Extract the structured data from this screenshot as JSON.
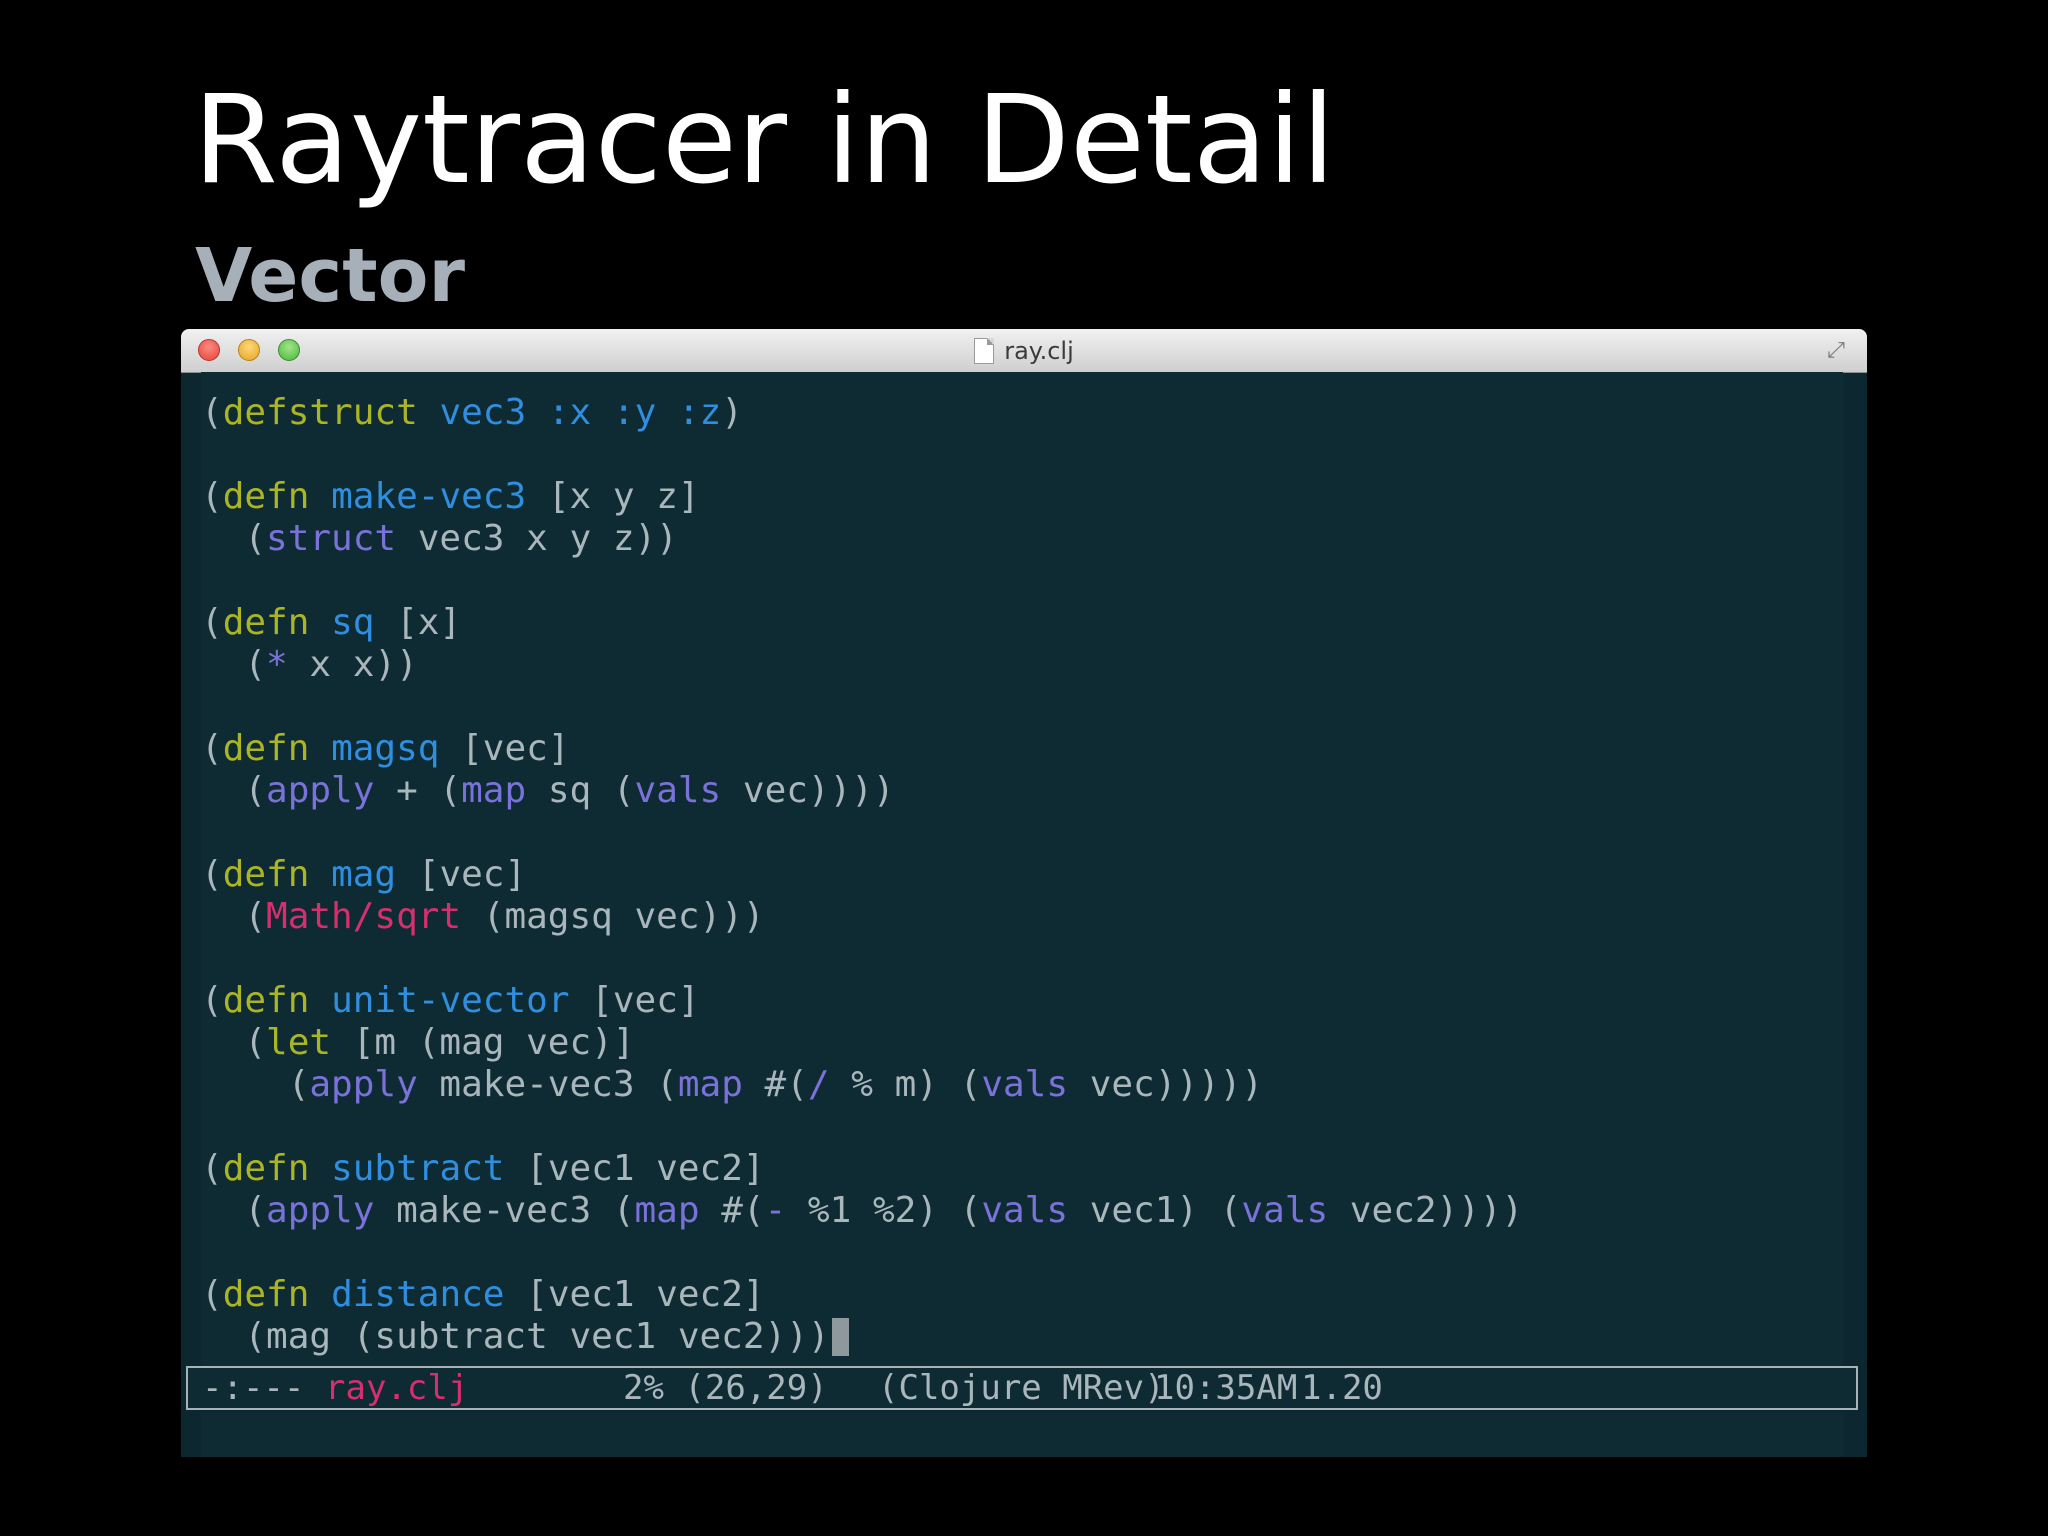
{
  "slide": {
    "title": "Raytracer in Detail",
    "subtitle": "Vector"
  },
  "window": {
    "title": "ray.clj"
  },
  "code_lines": [
    [
      {
        "t": "(",
        "c": ""
      },
      {
        "t": "defstruct",
        "c": "kw"
      },
      {
        "t": " ",
        "c": ""
      },
      {
        "t": "vec3",
        "c": "fn"
      },
      {
        "t": " ",
        "c": ""
      },
      {
        "t": ":x",
        "c": "fn"
      },
      {
        "t": " ",
        "c": ""
      },
      {
        "t": ":y",
        "c": "fn"
      },
      {
        "t": " ",
        "c": ""
      },
      {
        "t": ":z",
        "c": "fn"
      },
      {
        "t": ")",
        "c": ""
      }
    ],
    [],
    [
      {
        "t": "(",
        "c": ""
      },
      {
        "t": "defn",
        "c": "kw"
      },
      {
        "t": " ",
        "c": ""
      },
      {
        "t": "make-vec3",
        "c": "fn"
      },
      {
        "t": " [x y z]",
        "c": ""
      }
    ],
    [
      {
        "t": "  (",
        "c": ""
      },
      {
        "t": "struct",
        "c": "bi"
      },
      {
        "t": " vec3 x y z))",
        "c": ""
      }
    ],
    [],
    [
      {
        "t": "(",
        "c": ""
      },
      {
        "t": "defn",
        "c": "kw"
      },
      {
        "t": " ",
        "c": ""
      },
      {
        "t": "sq",
        "c": "fn"
      },
      {
        "t": " [x]",
        "c": ""
      }
    ],
    [
      {
        "t": "  (",
        "c": ""
      },
      {
        "t": "*",
        "c": "bi"
      },
      {
        "t": " x x))",
        "c": ""
      }
    ],
    [],
    [
      {
        "t": "(",
        "c": ""
      },
      {
        "t": "defn",
        "c": "kw"
      },
      {
        "t": " ",
        "c": ""
      },
      {
        "t": "magsq",
        "c": "fn"
      },
      {
        "t": " [vec]",
        "c": ""
      }
    ],
    [
      {
        "t": "  (",
        "c": ""
      },
      {
        "t": "apply",
        "c": "bi"
      },
      {
        "t": " + (",
        "c": ""
      },
      {
        "t": "map",
        "c": "bi"
      },
      {
        "t": " sq (",
        "c": ""
      },
      {
        "t": "vals",
        "c": "bi"
      },
      {
        "t": " vec))))",
        "c": ""
      }
    ],
    [],
    [
      {
        "t": "(",
        "c": ""
      },
      {
        "t": "defn",
        "c": "kw"
      },
      {
        "t": " ",
        "c": ""
      },
      {
        "t": "mag",
        "c": "fn"
      },
      {
        "t": " [vec]",
        "c": ""
      }
    ],
    [
      {
        "t": "  (",
        "c": ""
      },
      {
        "t": "Math/sqrt",
        "c": "java"
      },
      {
        "t": " (magsq vec)))",
        "c": ""
      }
    ],
    [],
    [
      {
        "t": "(",
        "c": ""
      },
      {
        "t": "defn",
        "c": "kw"
      },
      {
        "t": " ",
        "c": ""
      },
      {
        "t": "unit-vector",
        "c": "fn"
      },
      {
        "t": " [vec]",
        "c": ""
      }
    ],
    [
      {
        "t": "  (",
        "c": ""
      },
      {
        "t": "let",
        "c": "kw"
      },
      {
        "t": " [m (mag vec)]",
        "c": ""
      }
    ],
    [
      {
        "t": "    (",
        "c": ""
      },
      {
        "t": "apply",
        "c": "bi"
      },
      {
        "t": " make-vec3 (",
        "c": ""
      },
      {
        "t": "map",
        "c": "bi"
      },
      {
        "t": " #(",
        "c": ""
      },
      {
        "t": "/",
        "c": "bi"
      },
      {
        "t": " % m) (",
        "c": ""
      },
      {
        "t": "vals",
        "c": "bi"
      },
      {
        "t": " vec)))))",
        "c": ""
      }
    ],
    [],
    [
      {
        "t": "(",
        "c": ""
      },
      {
        "t": "defn",
        "c": "kw"
      },
      {
        "t": " ",
        "c": ""
      },
      {
        "t": "subtract",
        "c": "fn"
      },
      {
        "t": " [vec1 vec2]",
        "c": ""
      }
    ],
    [
      {
        "t": "  (",
        "c": ""
      },
      {
        "t": "apply",
        "c": "bi"
      },
      {
        "t": " make-vec3 (",
        "c": ""
      },
      {
        "t": "map",
        "c": "bi"
      },
      {
        "t": " #(",
        "c": ""
      },
      {
        "t": "-",
        "c": "bi"
      },
      {
        "t": " %1 %2) (",
        "c": ""
      },
      {
        "t": "vals",
        "c": "bi"
      },
      {
        "t": " vec1) (",
        "c": ""
      },
      {
        "t": "vals",
        "c": "bi"
      },
      {
        "t": " vec2))))",
        "c": ""
      }
    ],
    [],
    [
      {
        "t": "(",
        "c": ""
      },
      {
        "t": "defn",
        "c": "kw"
      },
      {
        "t": " ",
        "c": ""
      },
      {
        "t": "distance",
        "c": "fn"
      },
      {
        "t": " [vec1 vec2]",
        "c": ""
      }
    ],
    [
      {
        "t": "  (mag (subtract vec1 vec2)))",
        "c": ""
      }
    ]
  ],
  "modeline": {
    "status": "-:---",
    "buffer_name": "ray.clj",
    "position": "2% (26,29)",
    "mode": "(Clojure MRev)",
    "time": "10:35AM",
    "load": "1.20"
  },
  "colors": {
    "keyword": "#aab427",
    "function_name": "#2f8ede",
    "builtin": "#7b72d9",
    "java_interop": "#d52f6f",
    "default_text": "#a9b6bb",
    "background": "#0e2a33"
  }
}
